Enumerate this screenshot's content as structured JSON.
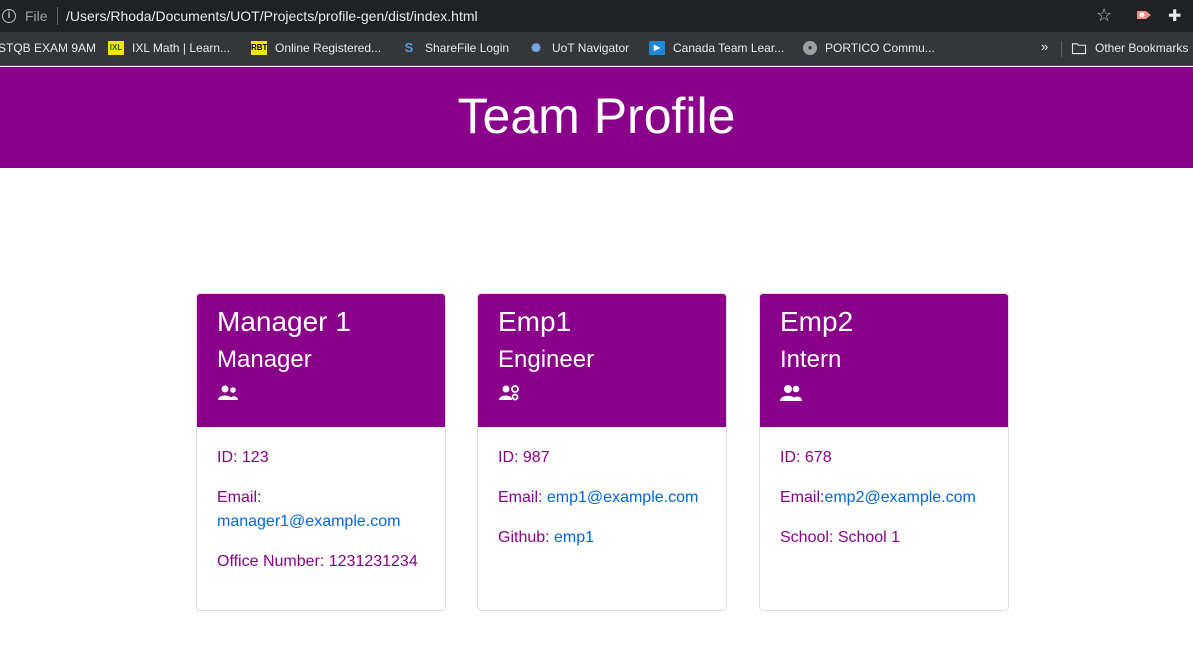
{
  "browser": {
    "file_label": "File",
    "url": "/Users/Rhoda/Documents/UOT/Projects/profile-gen/dist/index.html",
    "bookmarks": [
      {
        "icon": "",
        "label": "STQB EXAM 9AM"
      },
      {
        "icon": "IXL",
        "label": "IXL Math | Learn..."
      },
      {
        "icon": "RBT",
        "label": "Online Registered..."
      },
      {
        "icon": "S",
        "label": "ShareFile Login"
      },
      {
        "icon": "",
        "label": "UoT Navigator"
      },
      {
        "icon": "",
        "label": "Canada Team Lear..."
      },
      {
        "icon": "",
        "label": "PORTICO Commu..."
      }
    ],
    "other_bookmarks": "Other Bookmarks"
  },
  "page": {
    "title": "Team Profile"
  },
  "colors": {
    "brand": "#8b008b",
    "link": "#0066dd"
  },
  "cards": [
    {
      "name": "Manager 1",
      "role": "Manager",
      "icon": "user-tie-icon",
      "id_label": "ID: 123",
      "email_label": "Email:",
      "email": "manager1@example.com",
      "extra_label": "Office Number: 1231231234",
      "extra_link": ""
    },
    {
      "name": "Emp1",
      "role": "Engineer",
      "icon": "user-cog-icon",
      "id_label": "ID: 987",
      "email_label": "Email: ",
      "email": "emp1@example.com",
      "extra_label": "Github: ",
      "extra_link": "emp1"
    },
    {
      "name": "Emp2",
      "role": "Intern",
      "icon": "user-graduate-icon",
      "id_label": "ID: 678",
      "email_label": "Email:",
      "email": "emp2@example.com",
      "extra_label": "School: School 1",
      "extra_link": ""
    }
  ]
}
